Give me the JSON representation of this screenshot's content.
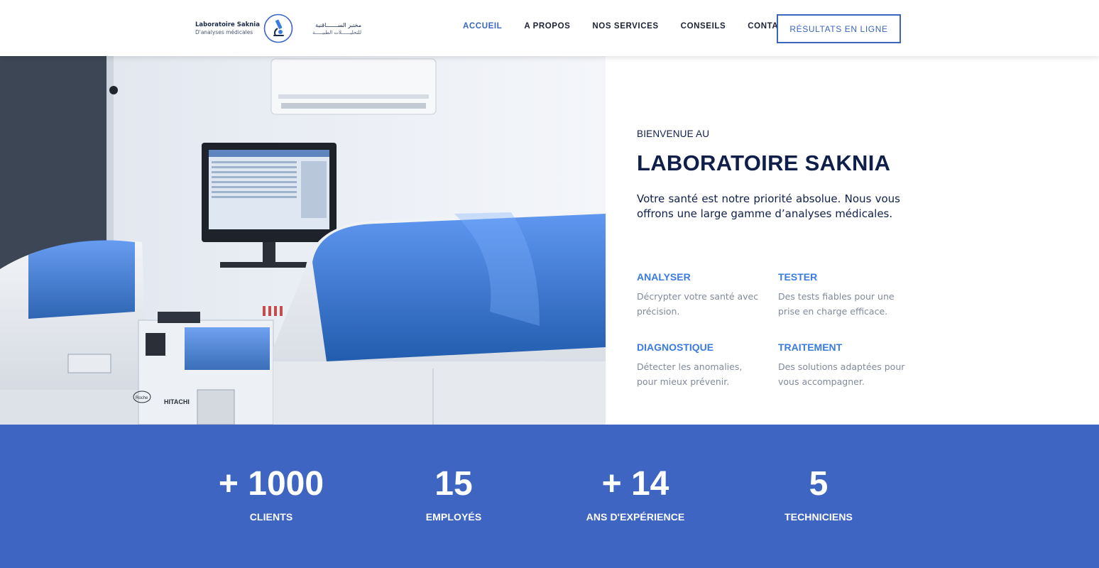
{
  "brand": {
    "name": "Laboratoire Saknia",
    "subtitle": "D'analyses médicales",
    "arabic_name": "مختبر الســـــــاقنية",
    "arabic_subtitle": "للتحليــــــلات الطبيـــــة",
    "colors": {
      "primary": "#3a66c0",
      "navy": "#0f1f4a",
      "stats_bg": "#3e65c1",
      "feature_title": "#3a7be0"
    }
  },
  "nav": {
    "items": [
      {
        "label": "ACCUEIL",
        "active": true
      },
      {
        "label": "A PROPOS",
        "active": false
      },
      {
        "label": "NOS SERVICES",
        "active": false
      },
      {
        "label": "CONSEILS",
        "active": false
      },
      {
        "label": "CONTACT",
        "active": false
      }
    ],
    "cta_label": "RÉSULTATS EN LIGNE"
  },
  "hero": {
    "image_icon": "laboratory-analyzer-photo",
    "machine_label_brand": "HITACHI",
    "machine_label_maker": "Roche",
    "kicker": "BIENVENUE AU",
    "title": "LABORATOIRE SAKNIA",
    "intro": "Votre santé est notre priorité absolue. Nous vous offrons une large gamme d’analyses médicales.",
    "features": [
      {
        "title": "ANALYSER",
        "desc": "Décrypter votre santé avec précision."
      },
      {
        "title": "TESTER",
        "desc": "Des tests fiables pour une prise en charge efficace."
      },
      {
        "title": "DIAGNOSTIQUE",
        "desc": "Détecter les anomalies, pour mieux prévenir."
      },
      {
        "title": "TRAITEMENT",
        "desc": "Des solutions adaptées pour vous accompagner."
      }
    ]
  },
  "stats": [
    {
      "value": "+ 1000",
      "label": "CLIENTS"
    },
    {
      "value": "15",
      "label": "EMPLOYÉS"
    },
    {
      "value": "+ 14",
      "label": "ANS D'EXPÉRIENCE"
    },
    {
      "value": "5",
      "label": "TECHNICIENS"
    }
  ]
}
